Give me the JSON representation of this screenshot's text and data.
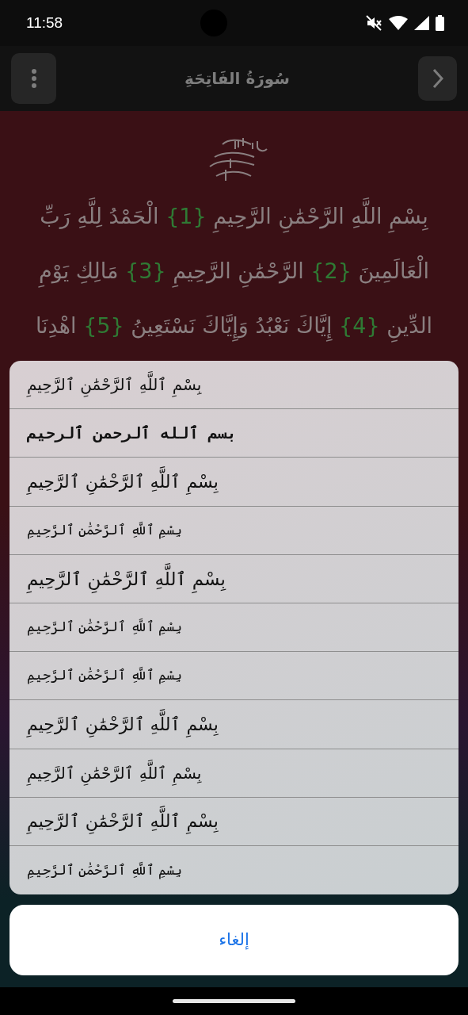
{
  "status_bar": {
    "time": "11:58"
  },
  "app_bar": {
    "title": "سُورَةُ الفَاتِحَةِ"
  },
  "verses": [
    {
      "kind": "text",
      "text": "بِسْمِ اللَّهِ الرَّحْمَٰنِ الرَّحِيمِ"
    },
    {
      "kind": "number",
      "text": "{1}"
    },
    {
      "kind": "text",
      "text": "الْحَمْدُ لِلَّهِ رَبِّ الْعَالَمِينَ"
    },
    {
      "kind": "number",
      "text": "{2}"
    },
    {
      "kind": "text",
      "text": "الرَّحْمَٰنِ الرَّحِيمِ"
    },
    {
      "kind": "number",
      "text": "{3}"
    },
    {
      "kind": "text",
      "text": "مَالِكِ يَوْمِ الدِّينِ"
    },
    {
      "kind": "number",
      "text": "{4}"
    },
    {
      "kind": "text",
      "text": "إِيَّاكَ نَعْبُدُ وَإِيَّاكَ نَسْتَعِينُ"
    },
    {
      "kind": "number",
      "text": "{5}"
    },
    {
      "kind": "text",
      "text": "اهْدِنَا"
    }
  ],
  "font_options": [
    {
      "label": "بِسْمِ ٱللَّهِ ٱلرَّحْمَٰنِ ٱلرَّحِيمِ"
    },
    {
      "label": "بسم ٱلله ٱلرحمن ٱلرحيم"
    },
    {
      "label": "بِسْمِ ٱللَّهِ ٱلرَّحْمَٰنِ ٱلرَّحِيمِ"
    },
    {
      "label": "بِسْمِ ٱللَّهِ ٱلرَّحْمَٰنِ ٱلرَّحِيمِ"
    },
    {
      "label": "بِسْمِ ٱللَّهِ ٱلرَّحْمَٰنِ ٱلرَّحِيمِ"
    },
    {
      "label": "بِسْمِ ٱللَّهِ ٱلرَّحْمَٰنِ ٱلرَّحِيمِ"
    },
    {
      "label": "بِسْمِ ٱللَّهِ ٱلرَّحْمَٰنِ ٱلرَّحِيمِ"
    },
    {
      "label": "بِسْمِ ٱللَّهِ ٱلرَّحْمَٰنِ ٱلرَّحِيمِ"
    },
    {
      "label": "بِسْمِ ٱللَّهِ ٱلرَّحْمَٰنِ ٱلرَّحِيمِ"
    },
    {
      "label": "بِسْمِ ٱللَّهِ ٱلرَّحْمَٰنِ ٱلرَّحِيمِ"
    },
    {
      "label": "بِسْمِ ٱللَّهِ ٱلرَّحْمَٰنِ ٱلرَّحِيمِ"
    }
  ],
  "cancel_button": {
    "label": "إلغاء"
  }
}
